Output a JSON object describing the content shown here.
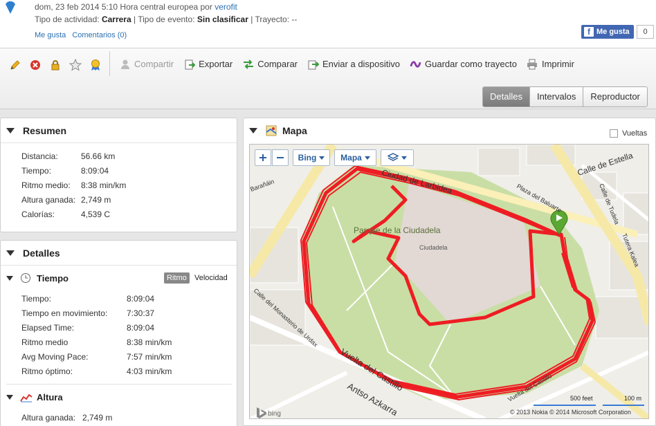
{
  "header": {
    "datetime": "dom, 23 feb 2014 5:10 Hora central europea por",
    "author": "verofit",
    "activity_label": "Tipo de actividad:",
    "activity_value": "Carrera",
    "event_label": "| Tipo de evento:",
    "event_value": "Sin clasificar",
    "route_label": "| Trayecto: --",
    "like_link": "Me gusta",
    "comments_link": "Comentarios (0)",
    "fb_like": "Me gusta",
    "fb_count": "0"
  },
  "toolbar": {
    "share": "Compartir",
    "export": "Exportar",
    "compare": "Comparar",
    "send": "Enviar a dispositivo",
    "save_route": "Guardar como trayecto",
    "print": "Imprimir"
  },
  "tabs": [
    "Detalles",
    "Intervalos",
    "Reproductor"
  ],
  "summary": {
    "title": "Resumen",
    "rows": [
      {
        "label": "Distancia:",
        "value": "56.66 km"
      },
      {
        "label": "Tiempo:",
        "value": "8:09:04"
      },
      {
        "label": "Ritmo medio:",
        "value": "8:38 min/km"
      },
      {
        "label": "Altura ganada:",
        "value": "2,749 m"
      },
      {
        "label": "Calorías:",
        "value": "4,539 C"
      }
    ]
  },
  "details": {
    "title": "Detalles",
    "time_section": "Tiempo",
    "toggle_pace": "Ritmo",
    "toggle_speed": "Velocidad",
    "rows": [
      {
        "label": "Tiempo:",
        "value": "8:09:04"
      },
      {
        "label": "Tiempo en movimiento:",
        "value": "7:30:37"
      },
      {
        "label": "Elapsed Time:",
        "value": "8:09:04"
      },
      {
        "label": "Ritmo medio",
        "value": "8:38 min/km"
      },
      {
        "label": "Avg Moving Pace:",
        "value": "7:57 min/km"
      },
      {
        "label": "Ritmo óptimo:",
        "value": "4:03 min/km"
      }
    ],
    "elevation_section": "Altura",
    "elevation_row": {
      "label": "Altura ganada:",
      "value": "2,749 m"
    }
  },
  "map": {
    "title": "Mapa",
    "laps_label": "Vueltas",
    "provider_btn": "Bing",
    "type_btn": "Mapa",
    "park_label": "Parque de la Ciudadela",
    "citadel_label": "Ciudadela",
    "streets": [
      "Calle de Estella",
      "Plaza del Baluarte",
      "Calle de Tudela",
      "Tutera Kalea",
      "Calle del Monasterio de Urdax",
      "Vuelta del Castillo",
      "Antso Azkarra",
      "Vuelta del Castillo",
      "Ciudad de Larbidea",
      "Barañáin"
    ],
    "scale_feet": "500 feet",
    "scale_m": "100 m",
    "attribution": "© 2013 Nokia   © 2014 Microsoft Corporation",
    "logo": "bing",
    "route_color": "#ee1d23"
  }
}
